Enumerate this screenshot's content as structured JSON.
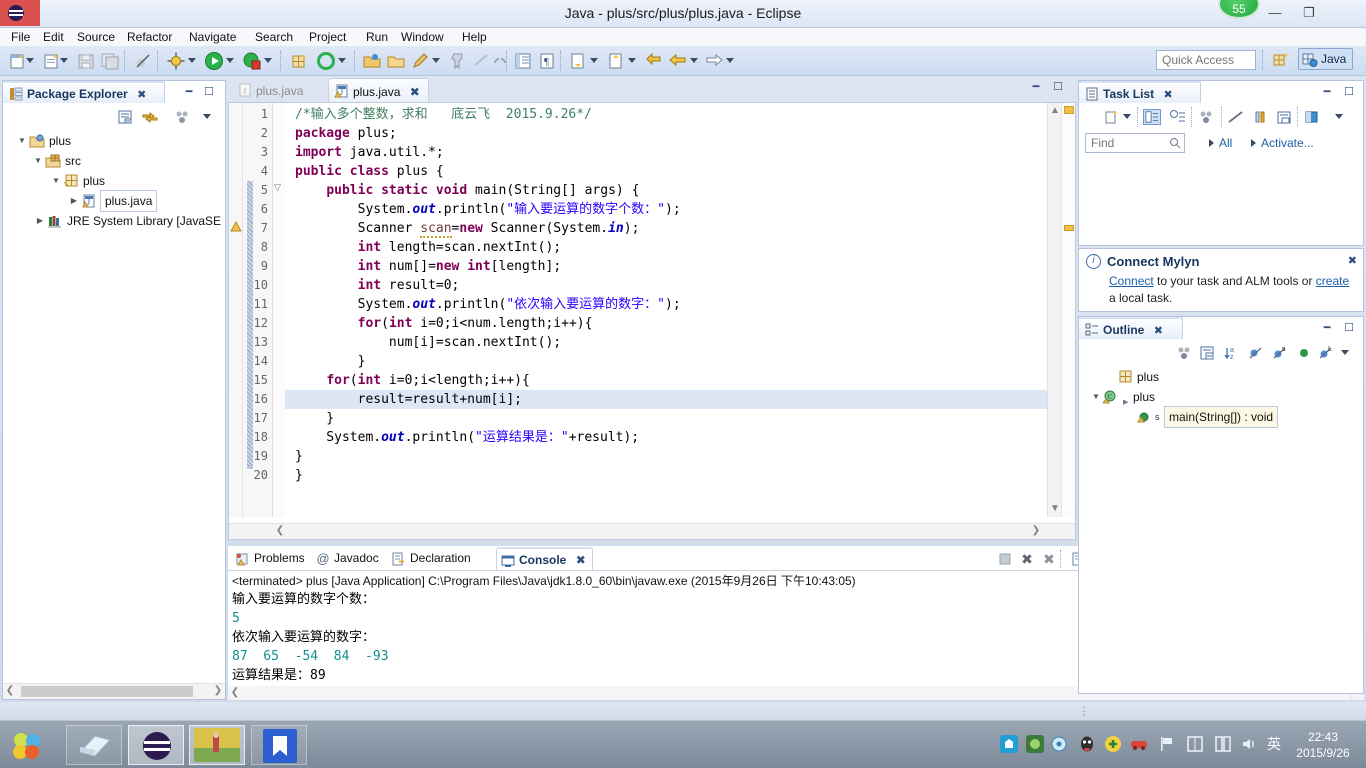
{
  "window": {
    "title": "Java - plus/src/plus/plus.java - Eclipse",
    "logo_icon": "eclipse-logo-icon",
    "badge_count": "55",
    "minimize_label": "—",
    "maximize_label": "❐",
    "close_label": "✕"
  },
  "menubar": {
    "items": [
      {
        "label": "File"
      },
      {
        "label": "Edit"
      },
      {
        "label": "Source"
      },
      {
        "label": "Refactor"
      },
      {
        "label": "Navigate"
      },
      {
        "label": "Search"
      },
      {
        "label": "Project"
      },
      {
        "label": "Run"
      },
      {
        "label": "Window"
      },
      {
        "label": "Help"
      }
    ]
  },
  "toolbar": {
    "quick_access_placeholder": "Quick Access",
    "perspective_label": "Java",
    "perspective_icon": "java-perspective-icon",
    "open_perspective_icon": "open-perspective-icon",
    "buttons": [
      {
        "name": "new-wizard-icon"
      },
      {
        "name": "new-java-file-icon"
      },
      {
        "name": "save-icon"
      },
      {
        "name": "save-all-icon"
      },
      {
        "name": "toggle-breakpoint-icon"
      },
      {
        "name": "debug-icon"
      },
      {
        "name": "run-icon"
      },
      {
        "name": "external-tools-icon"
      },
      {
        "name": "new-java-package-icon"
      },
      {
        "name": "open-type-icon"
      },
      {
        "name": "open-task-icon"
      },
      {
        "name": "open-folder-icon"
      },
      {
        "name": "mylyn-focus-icon"
      },
      {
        "name": "pin-icon"
      },
      {
        "name": "search-icon"
      },
      {
        "name": "link-icon"
      },
      {
        "name": "outline-view-icon"
      },
      {
        "name": "paragraph-icon"
      },
      {
        "name": "next-annotation-icon"
      },
      {
        "name": "previous-annotation-icon"
      },
      {
        "name": "last-edit-icon"
      },
      {
        "name": "back-icon"
      },
      {
        "name": "forward-icon"
      }
    ]
  },
  "package_explorer": {
    "title": "Package Explorer",
    "title_icon": "package-explorer-icon",
    "close_icon": "close-icon",
    "minimize_icon": "minimize-icon",
    "maximize_icon": "maximize-icon",
    "toolbar": [
      {
        "name": "collapse-all-icon"
      },
      {
        "name": "link-with-editor-icon"
      },
      {
        "name": "focus-on-active-task-icon"
      },
      {
        "name": "view-menu-icon"
      }
    ],
    "tree": [
      {
        "label": "plus",
        "depth": 0,
        "icon": "java-project-icon",
        "expanded": true
      },
      {
        "label": "src",
        "depth": 1,
        "icon": "source-folder-icon",
        "expanded": true
      },
      {
        "label": "plus",
        "depth": 2,
        "icon": "package-icon",
        "expanded": true
      },
      {
        "label": "plus.java",
        "depth": 3,
        "icon": "java-file-warning-icon",
        "expanded": false,
        "selected": true
      },
      {
        "label": "JRE System Library [JavaSE",
        "depth": 1,
        "icon": "jre-library-icon",
        "expanded": false
      }
    ]
  },
  "editor": {
    "tabs": [
      {
        "label": "plus.java",
        "icon": "java-file-icon",
        "active": false
      },
      {
        "label": "plus.java",
        "icon": "java-file-warning-icon",
        "active": true,
        "close_icon": "close-icon"
      }
    ],
    "highlighted_line": 16,
    "lines": [
      {
        "n": 1,
        "text": "/*输入多个整数，求和   底云飞  2015.9.26*/"
      },
      {
        "n": 2,
        "text": "package plus;"
      },
      {
        "n": 3,
        "text": "import java.util.*;"
      },
      {
        "n": 4,
        "text": "public class plus {"
      },
      {
        "n": 5,
        "text": "    public static void main(String[] args) {"
      },
      {
        "n": 6,
        "text": "        System.out.println(\"输入要运算的数字个数：\");"
      },
      {
        "n": 7,
        "text": "        Scanner scan=new Scanner(System.in);"
      },
      {
        "n": 8,
        "text": "        int length=scan.nextInt();"
      },
      {
        "n": 9,
        "text": "        int num[]=new int[length];"
      },
      {
        "n": 10,
        "text": "        int result=0;"
      },
      {
        "n": 11,
        "text": "        System.out.println(\"依次输入要运算的数字：\");"
      },
      {
        "n": 12,
        "text": "        for(int i=0;i<num.length;i++){"
      },
      {
        "n": 13,
        "text": "            num[i]=scan.nextInt();"
      },
      {
        "n": 14,
        "text": "        }"
      },
      {
        "n": 15,
        "text": "    for(int i=0;i<length;i++){"
      },
      {
        "n": 16,
        "text": "        result=result+num[i];"
      },
      {
        "n": 17,
        "text": "    }"
      },
      {
        "n": 18,
        "text": "    System.out.println(\"运算结果是：\"+result);"
      },
      {
        "n": 19,
        "text": "}"
      },
      {
        "n": 20,
        "text": "}"
      }
    ]
  },
  "bottom_panel": {
    "tabs": [
      {
        "label": "Problems",
        "icon": "problems-icon",
        "active": false
      },
      {
        "label": "Javadoc",
        "icon": "javadoc-icon",
        "active": false
      },
      {
        "label": "Declaration",
        "icon": "declaration-icon",
        "active": false
      },
      {
        "label": "Console",
        "icon": "console-icon",
        "active": true,
        "close_icon": "close-icon"
      }
    ],
    "toolbar": [
      {
        "name": "terminate-all-icon"
      },
      {
        "name": "remove-launch-icon"
      },
      {
        "name": "remove-all-terminated-icon"
      },
      {
        "name": "clear-console-icon"
      },
      {
        "name": "scroll-lock-icon"
      },
      {
        "name": "word-wrap-icon"
      },
      {
        "name": "show-console-when-output-icon"
      },
      {
        "name": "show-console-when-stderr-icon"
      },
      {
        "name": "pin-console-icon"
      },
      {
        "name": "display-selected-console-icon"
      },
      {
        "name": "open-console-icon"
      },
      {
        "name": "minimize-icon"
      },
      {
        "name": "maximize-icon"
      }
    ],
    "console": {
      "header": "<terminated> plus [Java Application] C:\\Program Files\\Java\\jdk1.8.0_60\\bin\\javaw.exe (2015年9月26日 下午10:43:05)",
      "lines": [
        {
          "text": "输入要运算的数字个数：",
          "kind": "out"
        },
        {
          "text": "5",
          "kind": "in"
        },
        {
          "text": "依次输入要运算的数字：",
          "kind": "out"
        },
        {
          "text": "87  65  -54  84  -93",
          "kind": "in"
        },
        {
          "text": "运算结果是：89",
          "kind": "out"
        }
      ]
    }
  },
  "task_list": {
    "title": "Task List",
    "title_icon": "task-list-icon",
    "close_icon": "close-icon",
    "find_placeholder": "Find",
    "find_icon": "search-icon",
    "all_label": "All",
    "activate_label": "Activate...",
    "toolbar": [
      {
        "name": "new-task-icon"
      },
      {
        "name": "categorized-presentation-icon"
      },
      {
        "name": "scheduled-presentation-icon"
      },
      {
        "name": "focus-on-workweek-icon"
      },
      {
        "name": "collapse-all-icon"
      },
      {
        "name": "synchronize-changed-icon"
      },
      {
        "name": "restore-task-list-icon"
      },
      {
        "name": "task-repositories-icon"
      },
      {
        "name": "view-menu-icon"
      }
    ]
  },
  "connect_mylyn": {
    "title": "Connect Mylyn",
    "info_icon": "info-icon",
    "close_icon": "close-icon",
    "link_connect": "Connect",
    "text_middle": " to your task and ALM tools or ",
    "link_create": "create",
    "text_end": " a local task."
  },
  "outline": {
    "title": "Outline",
    "title_icon": "outline-icon",
    "close_icon": "close-icon",
    "minimize_icon": "minimize-icon",
    "maximize_icon": "maximize-icon",
    "toolbar": [
      {
        "name": "focus-on-active-task-icon"
      },
      {
        "name": "collapse-all-icon"
      },
      {
        "name": "sort-icon"
      },
      {
        "name": "hide-fields-icon"
      },
      {
        "name": "hide-static-icon"
      },
      {
        "name": "hide-non-public-icon"
      },
      {
        "name": "hide-local-types-icon"
      },
      {
        "name": "view-menu-icon"
      }
    ],
    "tree": [
      {
        "label": "plus",
        "depth": 0,
        "icon": "package-icon",
        "expanded": null
      },
      {
        "label": "plus",
        "depth": 0,
        "icon": "class-icon",
        "expanded": true
      },
      {
        "label": "main(String[]) : void",
        "depth": 1,
        "icon": "method-public-static-icon",
        "selected": true
      }
    ]
  },
  "taskbar": {
    "start_icon": "start-orb-icon",
    "buttons": [
      {
        "name": "taskbar-notepad",
        "icon": "notepad-icon",
        "active": false
      },
      {
        "name": "taskbar-eclipse",
        "icon": "eclipse-logo-icon",
        "active": true
      },
      {
        "name": "taskbar-photo",
        "icon": "photo-thumbnail-icon",
        "active": true
      },
      {
        "name": "taskbar-wps",
        "icon": "wps-writer-icon",
        "active": false
      }
    ],
    "tray": [
      {
        "name": "tray-app-icon"
      },
      {
        "name": "tray-nvidia-icon"
      },
      {
        "name": "tray-disc-icon"
      },
      {
        "name": "tray-qq-icon"
      },
      {
        "name": "tray-360-icon"
      },
      {
        "name": "tray-car-icon"
      },
      {
        "name": "tray-flag-icon"
      },
      {
        "name": "tray-ime-box-icon"
      },
      {
        "name": "tray-ime-pen-icon"
      },
      {
        "name": "tray-volume-icon"
      },
      {
        "name": "tray-ime-lang-icon"
      }
    ],
    "ime_label": "英",
    "clock_time": "22:43",
    "clock_date": "2015/9/26"
  },
  "colors": {
    "keyword": "#7f0055",
    "string": "#2a00ff",
    "comment": "#3f7f5f",
    "field": "#0000c0",
    "console_input": "#109090",
    "accent": "#17375e",
    "close_red": "#d9504f"
  }
}
